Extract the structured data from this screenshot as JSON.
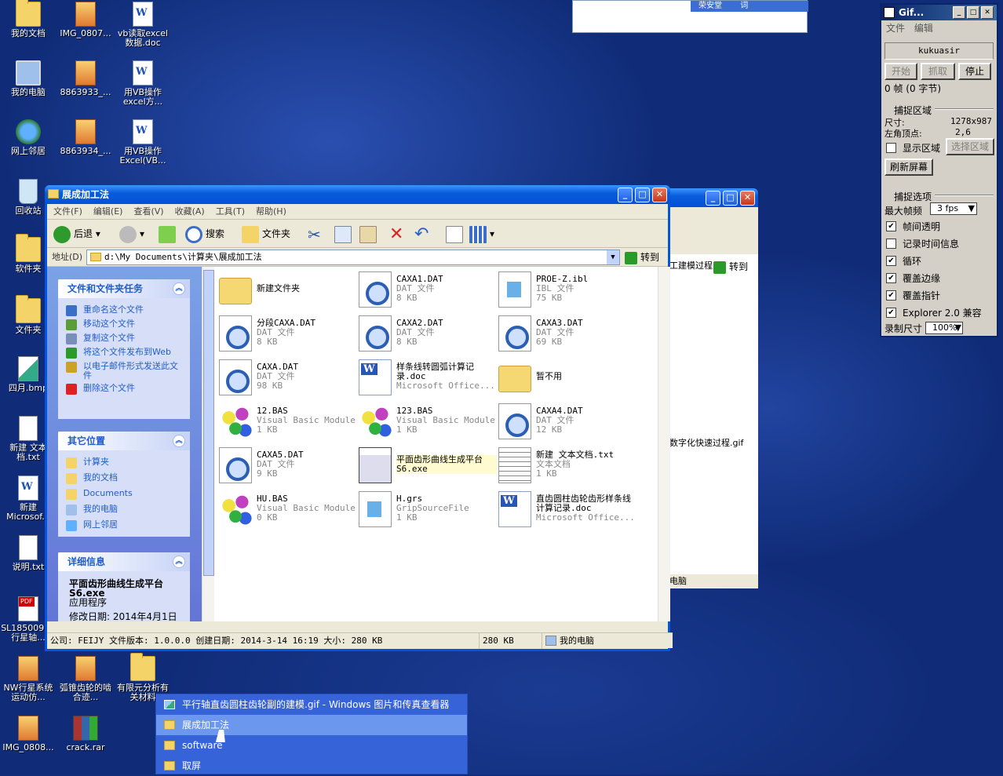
{
  "desktop_icons": [
    {
      "label": "我的文档",
      "type": "folder"
    },
    {
      "label": "IMG_0807...",
      "type": "img"
    },
    {
      "label": "vb读取excel数据.doc",
      "type": "doc"
    },
    {
      "label": "我的电脑",
      "type": "pc"
    },
    {
      "label": "8863933_...",
      "type": "img"
    },
    {
      "label": "用VB操作excel方...",
      "type": "doc"
    },
    {
      "label": "网上邻居",
      "type": "net"
    },
    {
      "label": "8863934_...",
      "type": "img"
    },
    {
      "label": "用VB操作Excel(VB...",
      "type": "doc"
    },
    {
      "label": "回收站",
      "type": "bin"
    },
    {
      "label": "软件夹",
      "type": "folder"
    },
    {
      "label": "文件夹",
      "type": "folder"
    },
    {
      "label": "四月.bmp",
      "type": "bmp"
    },
    {
      "label": "新建 文本档.txt",
      "type": "txt"
    },
    {
      "label": "新建 Microsof...",
      "type": "doc"
    },
    {
      "label": "说明.txt",
      "type": "txt"
    },
    {
      "label": "SL185009 背行星轴...",
      "type": "pdf"
    },
    {
      "label": "NW行星系统运动仿...",
      "type": "img"
    },
    {
      "label": "弧锥齿轮的啮合迹...",
      "type": "img"
    },
    {
      "label": "有限元分析有关材料",
      "type": "folder"
    },
    {
      "label": "IMG_0808...",
      "type": "img"
    },
    {
      "label": "crack.rar",
      "type": "rar"
    }
  ],
  "explorer": {
    "title": "展成加工法",
    "menu": [
      "文件(F)",
      "编辑(E)",
      "查看(V)",
      "收藏(A)",
      "工具(T)",
      "帮助(H)"
    ],
    "toolbar": {
      "back": "后退",
      "search": "搜索",
      "folders": "文件夹"
    },
    "address_label": "地址(D)",
    "address": "d:\\My Documents\\计算夹\\展成加工法",
    "go": "转到",
    "tasks": {
      "file_title": "文件和文件夹任务",
      "file_items": [
        "重命名这个文件",
        "移动这个文件",
        "复制这个文件",
        "将这个文件发布到Web",
        "以电子邮件形式发送此文件",
        "删除这个文件"
      ],
      "other_title": "其它位置",
      "other_items": [
        "计算夹",
        "我的文档",
        "Documents",
        "我的电脑",
        "网上邻居"
      ],
      "detail_title": "详细信息",
      "detail_name": "平面齿形曲线生成平台S6.exe",
      "detail_type": "应用程序",
      "detail_date": "修改日期: 2014年4月1日"
    },
    "files": [
      {
        "name": "新建文件夹",
        "l2": "",
        "l3": "",
        "type": "folder"
      },
      {
        "name": "CAXA1.DAT",
        "l2": "DAT 文件",
        "l3": "8 KB",
        "type": "dat"
      },
      {
        "name": "PROE-Z.ibl",
        "l2": "IBL 文件",
        "l3": "75 KB",
        "type": "ibl"
      },
      {
        "name": "分段CAXA.DAT",
        "l2": "DAT 文件",
        "l3": "8 KB",
        "type": "dat"
      },
      {
        "name": "CAXA2.DAT",
        "l2": "DAT 文件",
        "l3": "8 KB",
        "type": "dat"
      },
      {
        "name": "CAXA3.DAT",
        "l2": "DAT 文件",
        "l3": "69 KB",
        "type": "dat"
      },
      {
        "name": "CAXA.DAT",
        "l2": "DAT 文件",
        "l3": "98 KB",
        "type": "dat"
      },
      {
        "name": "样条线转圆弧计算记录.doc",
        "l2": "Microsoft Office...",
        "l3": "",
        "type": "word"
      },
      {
        "name": "暂不用",
        "l2": "",
        "l3": "",
        "type": "folder"
      },
      {
        "name": "12.BAS",
        "l2": "Visual Basic Module",
        "l3": "1 KB",
        "type": "bas"
      },
      {
        "name": "123.BAS",
        "l2": "Visual Basic Module",
        "l3": "1 KB",
        "type": "bas"
      },
      {
        "name": "CAXA4.DAT",
        "l2": "DAT 文件",
        "l3": "12 KB",
        "type": "dat"
      },
      {
        "name": "CAXA5.DAT",
        "l2": "DAT 文件",
        "l3": "9 KB",
        "type": "dat"
      },
      {
        "name": "平面齿形曲线生成平台S6.exe",
        "l2": "",
        "l3": "",
        "type": "exe"
      },
      {
        "name": "新建 文本文档.txt",
        "l2": "文本文档",
        "l3": "1 KB",
        "type": "txt"
      },
      {
        "name": "HU.BAS",
        "l2": "Visual Basic Module",
        "l3": "0 KB",
        "type": "bas"
      },
      {
        "name": "H.grs",
        "l2": "GripSourceFile",
        "l3": "1 KB",
        "type": "ibl"
      },
      {
        "name": "直齿圆柱齿轮齿形样条线计算记录.doc",
        "l2": "Microsoft Office...",
        "l3": "",
        "type": "word"
      }
    ],
    "status": {
      "info": "公司: FEIJY 文件版本: 1.0.0.0 创建日期: 2014-3-14 16:19 大小: 280 KB",
      "size": "280 KB",
      "location": "我的电脑"
    }
  },
  "back_window": {
    "go": "转到",
    "text1": "工建模过程.if",
    "text2": "数字化快速过程.gif",
    "status": "电脑"
  },
  "gif_tool": {
    "title": "Gif...",
    "menu": [
      "文件",
      "编辑"
    ],
    "user": "kukuasir",
    "buttons": [
      "开始",
      "抓取",
      "停止"
    ],
    "frames": "0 帧 (0 字节)",
    "capture_area": "捕捉区域",
    "size_label": "尺寸:",
    "size_val": "1278x987",
    "corner_label": "左角顶点:",
    "corner_val": "2,6",
    "show_area": "显示区域",
    "select_area": "选择区域",
    "refresh": "刷新屏幕",
    "capture_opts": "捕捉选项",
    "max_fps_label": "最大帧频",
    "max_fps": "3 fps",
    "options": [
      {
        "label": "帧间透明",
        "checked": true
      },
      {
        "label": "记录时间信息",
        "checked": false
      },
      {
        "label": "循环",
        "checked": true
      },
      {
        "label": "覆盖边缘",
        "checked": true
      },
      {
        "label": "覆盖指针",
        "checked": true
      },
      {
        "label": "Explorer 2.0 兼容",
        "checked": true
      }
    ],
    "rec_size_label": "录制尺寸",
    "rec_size": "100%"
  },
  "top_window": {
    "tab": "荣安堂",
    "t2": "词"
  },
  "taskbar_menu": [
    {
      "label": "平行轴直齿圆柱齿轮副的建模.gif - Windows 图片和传真查看器",
      "icon": "pic"
    },
    {
      "label": "展成加工法",
      "icon": "folder"
    },
    {
      "label": "software",
      "icon": "folder"
    },
    {
      "label": "取屏",
      "icon": "folder"
    }
  ]
}
